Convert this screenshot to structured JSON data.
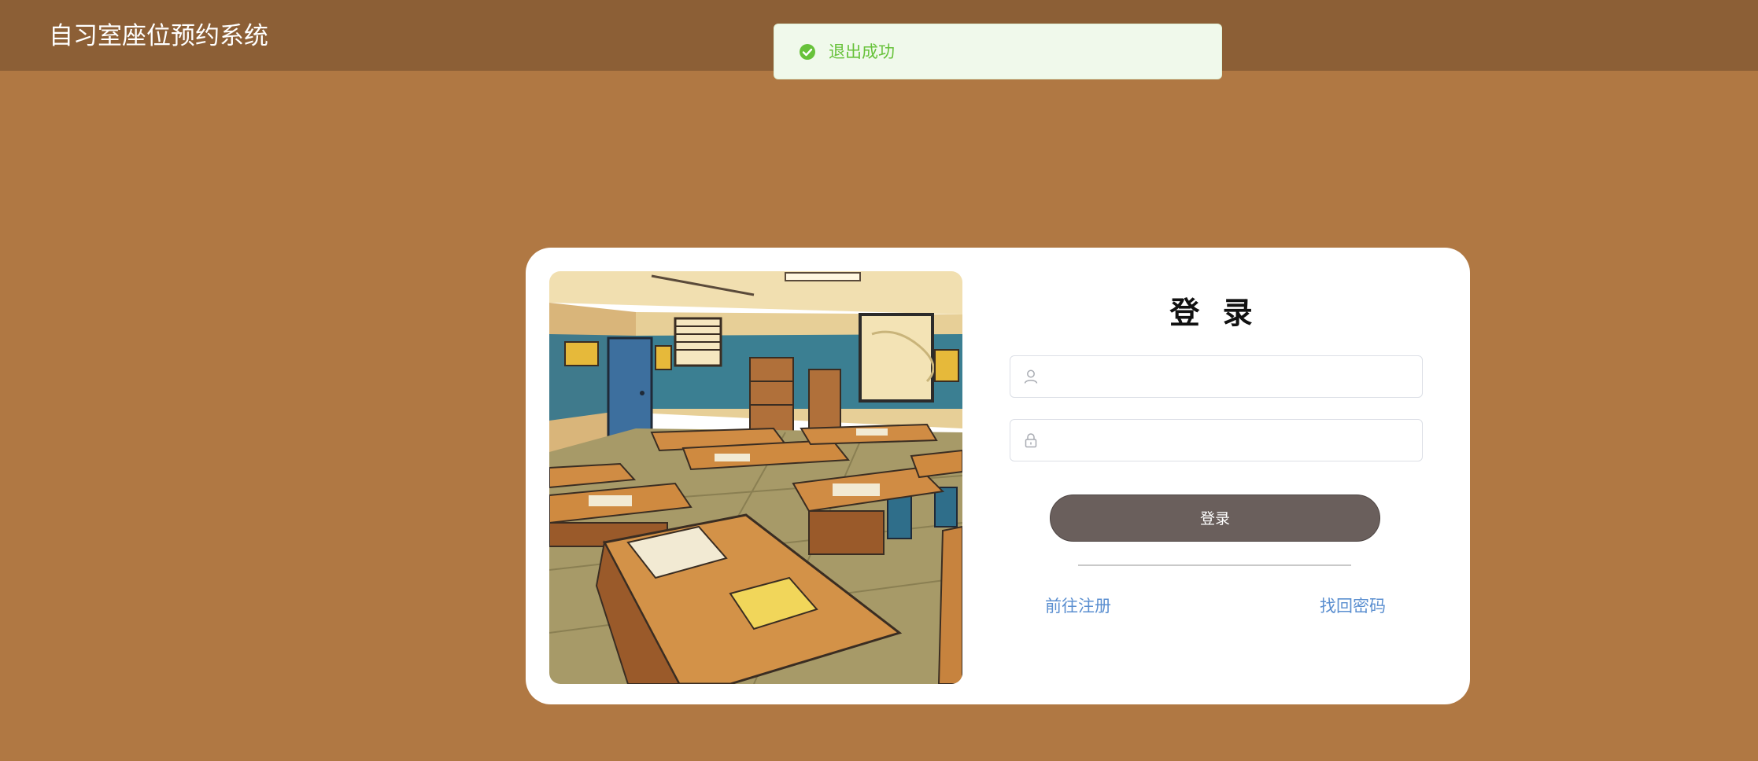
{
  "header": {
    "title": "自习室座位预约系统"
  },
  "toast": {
    "message": "退出成功",
    "icon": "success-check-icon",
    "color": "#67c23a"
  },
  "login": {
    "title": "登 录",
    "username": {
      "value": "",
      "placeholder": "",
      "icon": "user-icon"
    },
    "password": {
      "value": "",
      "placeholder": "",
      "icon": "lock-icon"
    },
    "submit_label": "登录",
    "register_link": "前往注册",
    "forgot_link": "找回密码"
  },
  "illustration": {
    "subject": "classroom-illustration"
  },
  "colors": {
    "background": "#b07843",
    "header": "#8c5f36",
    "button": "#6a5f5c",
    "link": "#5b8fd0"
  }
}
